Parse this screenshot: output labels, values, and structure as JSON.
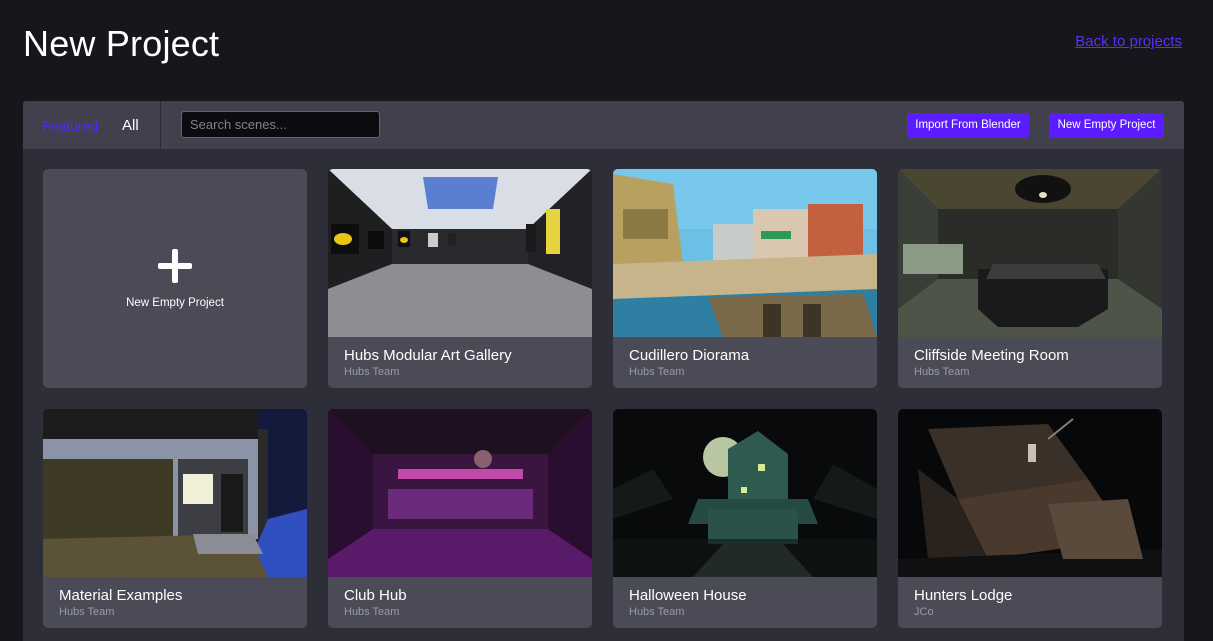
{
  "header": {
    "title": "New Project",
    "back_link": "Back to projects"
  },
  "toolbar": {
    "tabs": [
      {
        "label": "Featured",
        "active": true
      },
      {
        "label": "All",
        "active": false
      }
    ],
    "search_placeholder": "Search scenes...",
    "import_button": "Import From Blender",
    "new_empty_button": "New Empty Project"
  },
  "new_card": {
    "icon": "plus-icon",
    "label": "New Empty Project"
  },
  "scenes": [
    {
      "title": "Hubs Modular Art Gallery",
      "author": "Hubs Team"
    },
    {
      "title": "Cudillero Diorama",
      "author": "Hubs Team"
    },
    {
      "title": "Cliffside Meeting Room",
      "author": "Hubs Team"
    },
    {
      "title": "Material Examples",
      "author": "Hubs Team"
    },
    {
      "title": "Club Hub",
      "author": "Hubs Team"
    },
    {
      "title": "Halloween House",
      "author": "Hubs Team"
    },
    {
      "title": "Hunters Lodge",
      "author": "JCo"
    }
  ],
  "colors": {
    "background": "#16161c",
    "panel": "#2d2e38",
    "toolbar": "#40414d",
    "card": "#4a4b57",
    "accent": "#5b1dff",
    "link": "#5b2eff"
  }
}
